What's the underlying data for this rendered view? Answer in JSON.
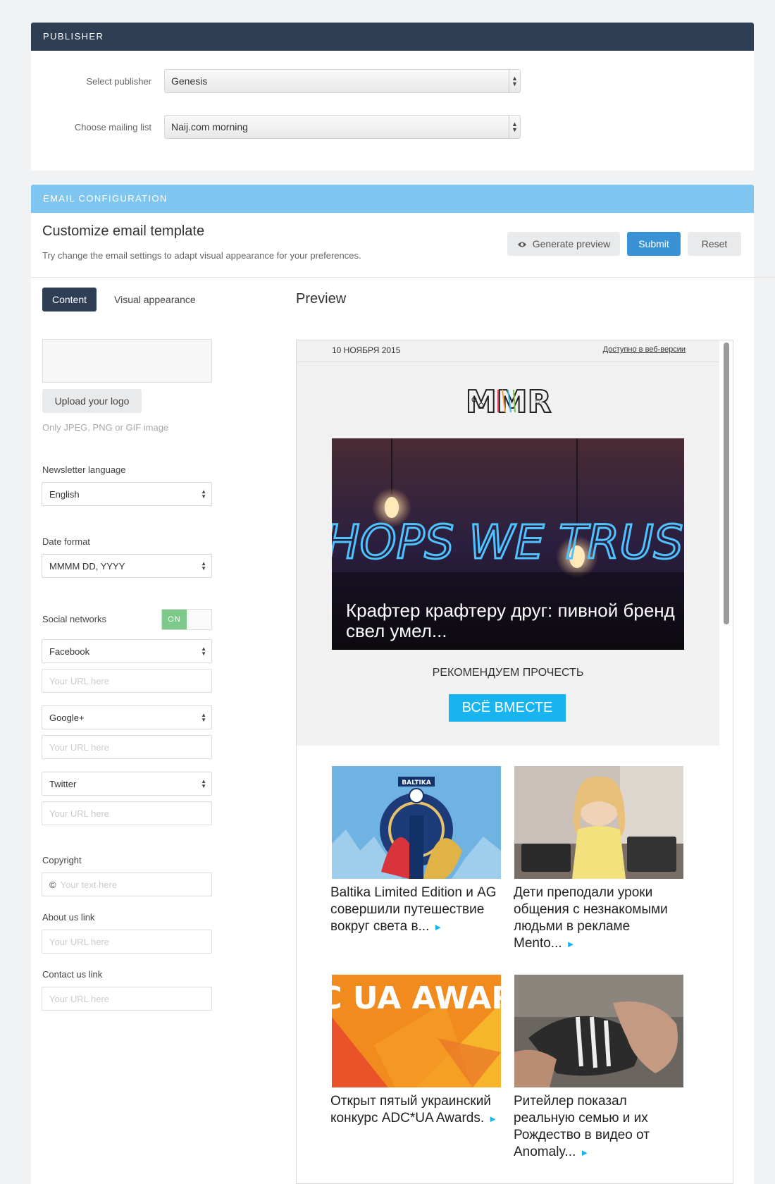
{
  "publisher": {
    "header": "PUBLISHER",
    "select_label": "Select publisher",
    "select_value": "Genesis",
    "list_label": "Choose mailing list",
    "list_value": "Naij.com morning"
  },
  "email_config": {
    "header": "EMAIL CONFIGURATION",
    "title": "Customize email template",
    "subtitle": "Try change the email settings to adapt visual appearance for your preferences.",
    "buttons": {
      "preview": "Generate preview",
      "submit": "Submit",
      "reset": "Reset"
    },
    "tabs": {
      "content": "Content",
      "visual": "Visual appearance"
    },
    "preview_title": "Preview"
  },
  "form": {
    "upload_label": "Upload your logo",
    "upload_hint": "Only JPEG, PNG or GIF image",
    "language_label": "Newsletter language",
    "language_value": "English",
    "date_label": "Date format",
    "date_value": "MMMM DD, YYYY",
    "social_label": "Social networks",
    "toggle": "ON",
    "networks": [
      {
        "name": "Facebook",
        "placeholder": "Your URL here"
      },
      {
        "name": "Google+",
        "placeholder": "Your URL here"
      },
      {
        "name": "Twitter",
        "placeholder": "Your URL here"
      }
    ],
    "copyright_label": "Copyright",
    "copyright_symbol": "©",
    "copyright_placeholder": "Your text here",
    "about_label": "About us link",
    "about_placeholder": "Your URL here",
    "contact_label": "Contact us link",
    "contact_placeholder": "Your URL here"
  },
  "preview": {
    "date": "10 НОЯБРЯ 2015",
    "web_version": "Доступно в веб-версии",
    "logo_text": "MMR",
    "hero_neon": "HOPS WE TRUST",
    "hero_title": "Крафтер крафтеру друг: пивной бренд свел умел...",
    "recommend": "РЕКОМЕНДУЕМ ПРОЧЕСТЬ",
    "cta": "ВСЁ ВМЕСТЕ",
    "cards": [
      {
        "title": "Baltika Limited Edition и AG совершили путешествие вокруг света в...",
        "img_label": "BALTIKA"
      },
      {
        "title": "Дети преподали уроки общения с незнакомыми людьми в рекламе Mento...",
        "img_label": ""
      },
      {
        "title": "Открыт пятый украинский конкурс ADC*UA Awards.",
        "img_label": "ADC UA AWARDS"
      },
      {
        "title": "Ритейлер показал реальную семью и их Рождество в видео от Anomaly...",
        "img_label": ""
      }
    ],
    "more_glyph": "►"
  },
  "colors": {
    "publisher_header": "#2d3e55",
    "config_header": "#7ec6ef",
    "submit": "#3a92d6",
    "cta": "#17b4ef",
    "toggle_on": "#7cc98a"
  }
}
